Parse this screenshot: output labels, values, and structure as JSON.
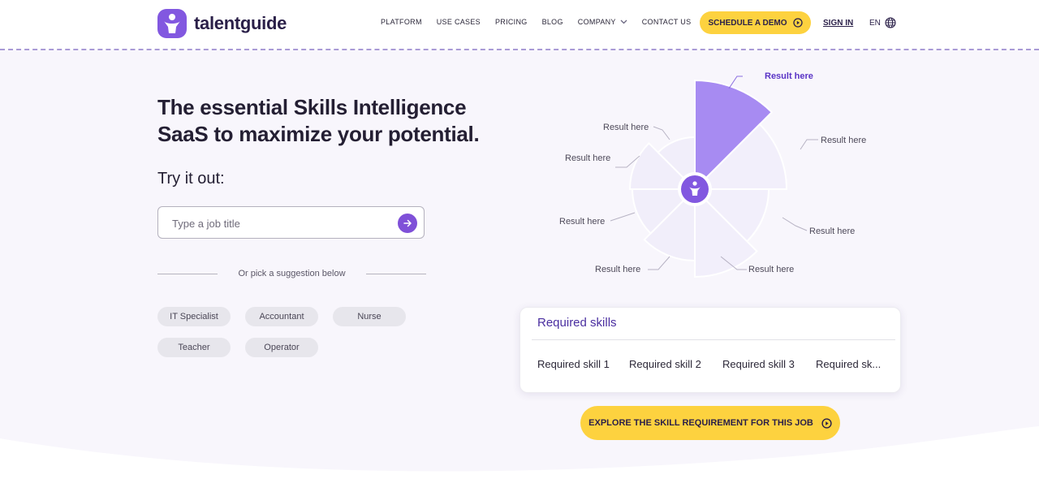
{
  "brand": {
    "name": "talentguide",
    "accent": "#8258e0",
    "cta": "#fdd23f"
  },
  "nav": {
    "items": [
      {
        "label": "PLATFORM"
      },
      {
        "label": "USE CASES"
      },
      {
        "label": "PRICING"
      },
      {
        "label": "BLOG"
      },
      {
        "label": "COMPANY",
        "icon": "chevron-down-icon"
      },
      {
        "label": "CONTACT US"
      }
    ],
    "demo_label": "SCHEDULE A DEMO",
    "signin_label": "SIGN IN",
    "lang_label": "EN"
  },
  "hero": {
    "title_line1": "The essential Skills Intelligence",
    "title_line2": "SaaS to maximize your potential.",
    "try_label": "Try it out:",
    "search_placeholder": "Type a job title",
    "divider_text": "Or pick a suggestion below",
    "suggestions": [
      "IT Specialist",
      "Accountant",
      "Nurse",
      "Teacher",
      "Operator"
    ]
  },
  "chart": {
    "result_labels": [
      "Result here",
      "Result here",
      "Result here",
      "Result here",
      "Result here",
      "Result here",
      "Result here",
      "Result here"
    ],
    "highlight_color": "#a78bf2"
  },
  "skills": {
    "title": "Required skills",
    "items": [
      "Required skill 1",
      "Required skill 2",
      "Required skill 3",
      "Required sk..."
    ]
  },
  "explore_label": "EXPLORE THE SKILL REQUIREMENT FOR THIS JOB"
}
